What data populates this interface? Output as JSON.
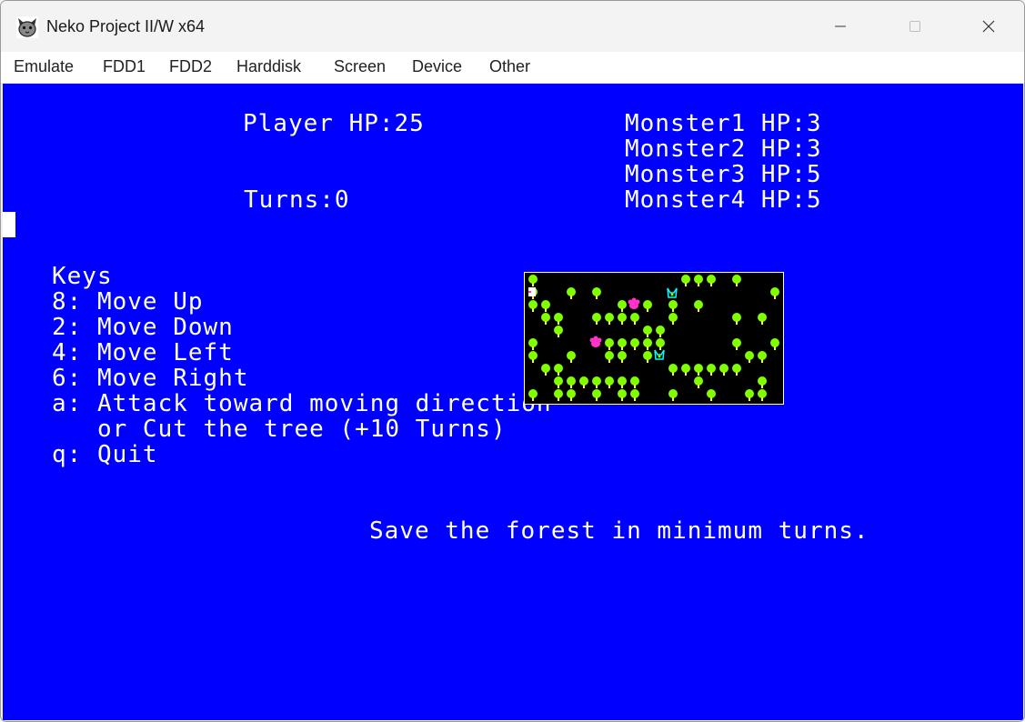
{
  "window": {
    "title": "Neko Project II/W x64",
    "icon": "cat-face-icon"
  },
  "controls": {
    "minimize_icon": "minimize-icon",
    "maximize_icon": "maximize-icon",
    "close_icon": "close-icon"
  },
  "menu": {
    "items": [
      "Emulate",
      "FDD1",
      "FDD2",
      "Harddisk",
      "Screen",
      "Device",
      "Other"
    ]
  },
  "screen": {
    "background": "#0000ff",
    "player_hp": "Player HP:25",
    "turns": "Turns:0",
    "monsters": [
      "Monster1 HP:3",
      "Monster2 HP:3",
      "Monster3 HP:5",
      "Monster4 HP:5"
    ],
    "keys_title": "Keys",
    "keys": [
      "8: Move Up",
      "2: Move Down",
      "4: Move Left",
      "6: Move Right",
      "a: Attack toward moving direction",
      "   or Cut the tree (+10 Turns)",
      "q: Quit"
    ],
    "message": "Save the forest in minimum turns."
  },
  "map": {
    "tree_color": "#7fff00",
    "trunk_color": "#ffff00",
    "monster_color": "#ff33cc",
    "player_color": "#ffffff",
    "enemy2_color": "#00ffff"
  }
}
